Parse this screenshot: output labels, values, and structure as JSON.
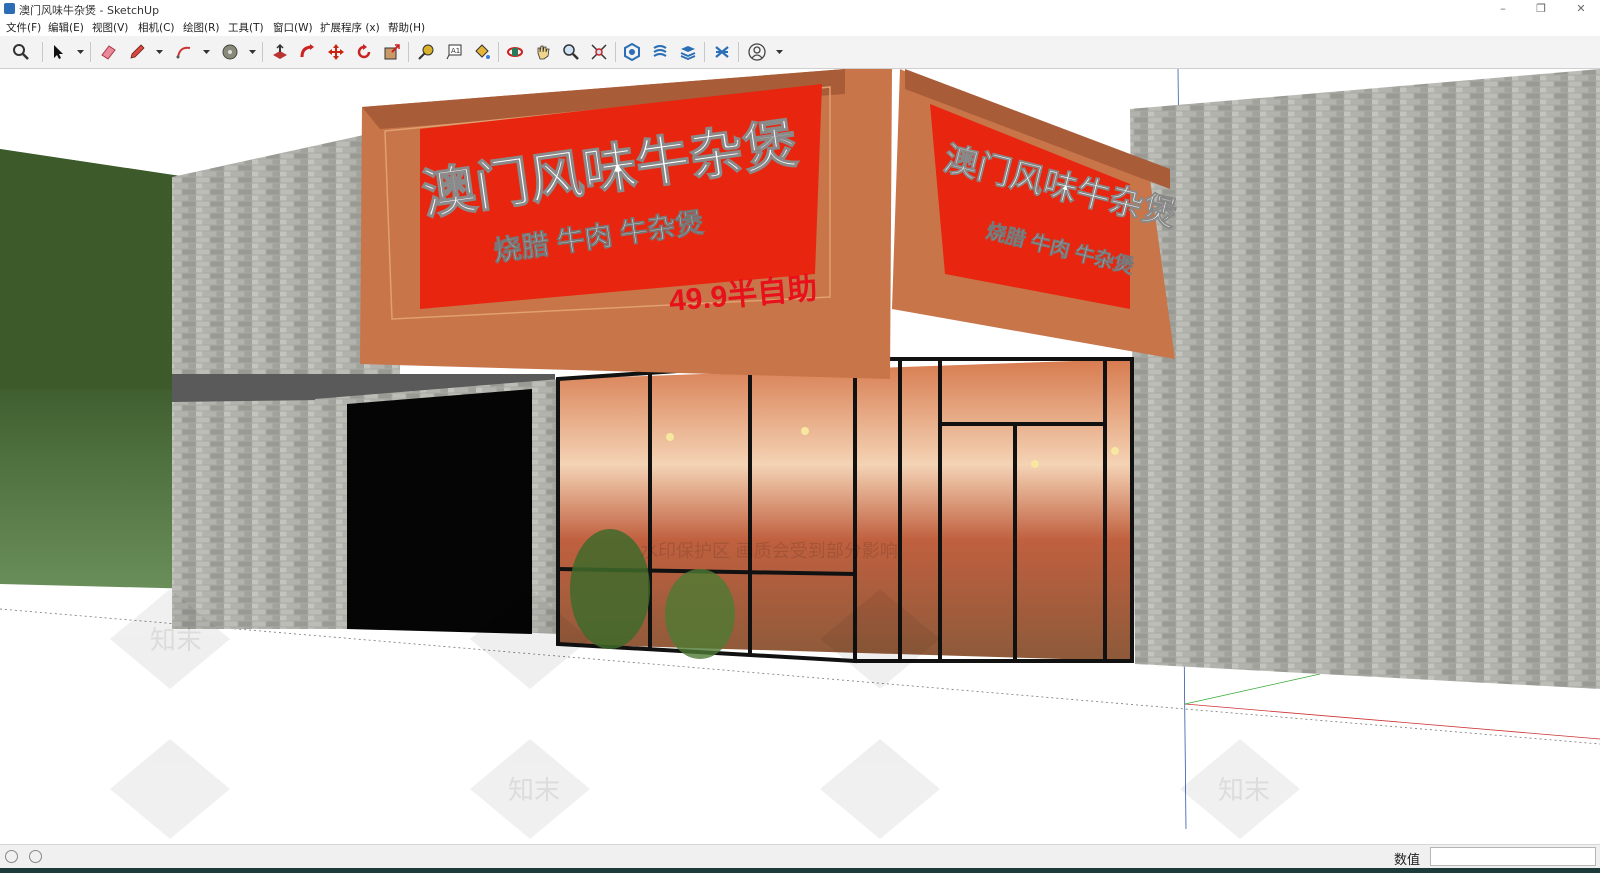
{
  "window": {
    "title": "澳门风味牛杂煲 - SketchUp",
    "minimize": "–",
    "restore": "❐",
    "close": "✕"
  },
  "menu": [
    {
      "label": "文件(F)"
    },
    {
      "label": "编辑(E)"
    },
    {
      "label": "视图(V)"
    },
    {
      "label": "相机(C)"
    },
    {
      "label": "绘图(R)"
    },
    {
      "label": "工具(T)"
    },
    {
      "label": "窗口(W)"
    },
    {
      "label": "扩展程序 (x)"
    },
    {
      "label": "帮助(H)"
    }
  ],
  "toolbar": {
    "tools": [
      "zoom-extents",
      "select",
      "eraser",
      "pencil-line",
      "arc",
      "shape",
      "push-pull",
      "follow-me",
      "move",
      "rotate",
      "scale",
      "tape-measure",
      "text",
      "paint-bucket",
      "orbit",
      "pan",
      "zoom",
      "zoom-window",
      "3d-warehouse",
      "extension-warehouse",
      "layout",
      "extension-manager",
      "account"
    ]
  },
  "scene": {
    "sign_main_title": "澳门风味牛杂煲",
    "sign_main_subtitle": "烧腊 牛肉 牛杂煲",
    "sign_price": "49.9半自助",
    "sign_side_title": "澳门风味牛杂煲",
    "sign_side_subtitle": "烧腊 牛肉 牛杂煲",
    "watermark_brand": "知末",
    "watermark_notice": "水印保护区 画质会受到部分影响",
    "colors": {
      "sign_orange": "#c8754a",
      "sign_red": "#e8250f",
      "price_red": "#e8101a",
      "brick": "#a9a9a4",
      "tree_green": "#3c5a2c"
    }
  },
  "statusbar": {
    "vcb_label": "数值",
    "vcb_value": ""
  }
}
